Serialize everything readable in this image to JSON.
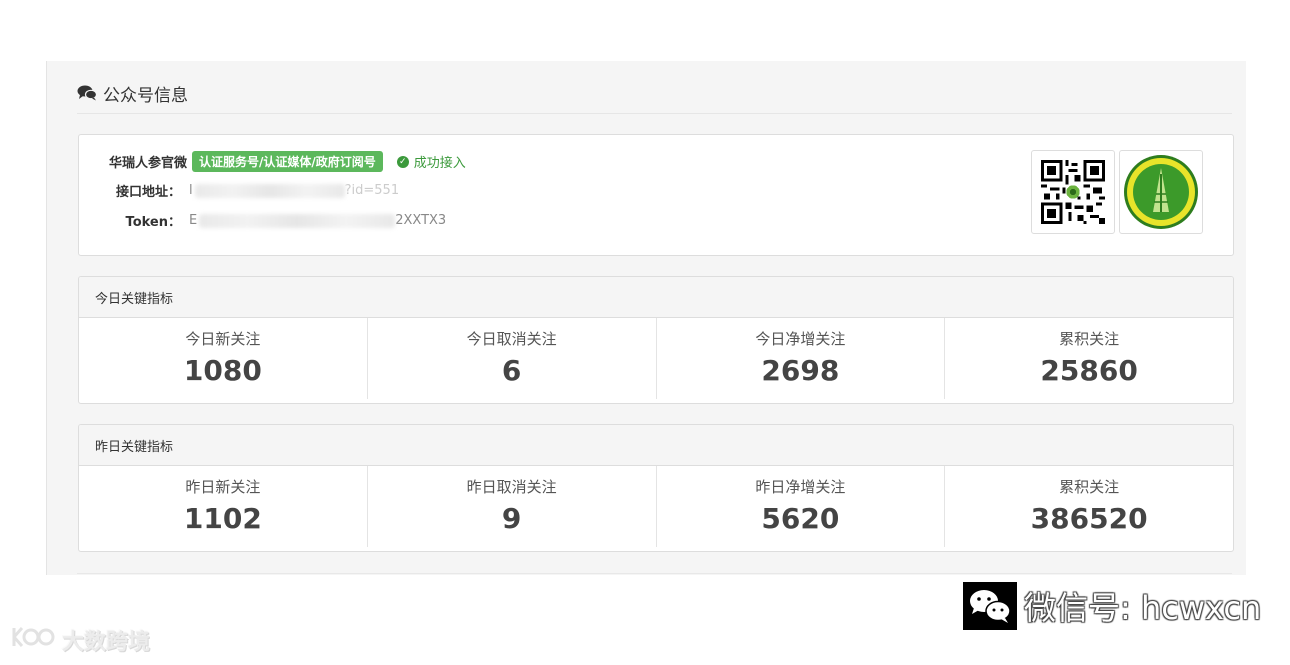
{
  "panel": {
    "title": "公众号信息",
    "title_icon": "chat-bubbles-icon"
  },
  "account": {
    "name": "华瑞人参官微",
    "verified_badge": "认证服务号/认证媒体/政府订阅号",
    "status": "成功接入",
    "api_label": "接口地址：",
    "api_value_visible_prefix": "l",
    "api_value_visible_suffix": "?id=551",
    "token_label": "Token：",
    "token_value_visible_prefix": "E",
    "token_value_visible_suffix": "2XXTX3",
    "qr_icon": "qr-code-icon",
    "logo_icon": "brand-logo-icon"
  },
  "today": {
    "header": "今日关键指标",
    "metrics": [
      {
        "label": "今日新关注",
        "value": "1080"
      },
      {
        "label": "今日取消关注",
        "value": "6"
      },
      {
        "label": "今日净增关注",
        "value": "2698"
      },
      {
        "label": "累积关注",
        "value": "25860"
      }
    ]
  },
  "yesterday": {
    "header": "昨日关键指标",
    "metrics": [
      {
        "label": "昨日新关注",
        "value": "1102"
      },
      {
        "label": "昨日取消关注",
        "value": "9"
      },
      {
        "label": "昨日净增关注",
        "value": "5620"
      },
      {
        "label": "累积关注",
        "value": "386520"
      }
    ]
  },
  "watermarks": {
    "left": "大数跨境",
    "right": "微信号: hcwxcn"
  },
  "colors": {
    "success": "#5cb85c",
    "panel_bg": "#f5f5f5",
    "border": "#dddddd"
  }
}
